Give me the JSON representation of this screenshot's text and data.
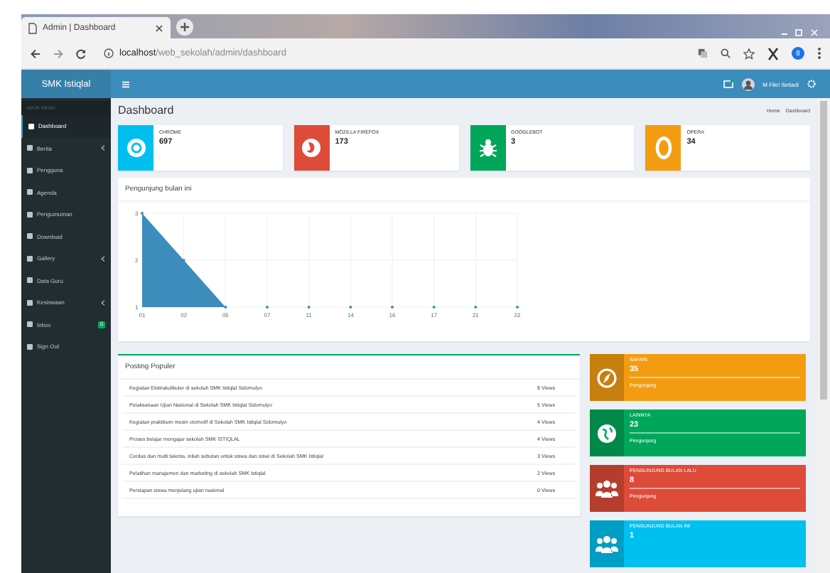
{
  "browser": {
    "tab_title": "Admin | Dashboard",
    "url_host": "localhost",
    "url_path": "/web_sekolah/admin/dashboard",
    "profile": "8"
  },
  "header": {
    "brand": "SMK Istiqlal",
    "user": "M Fikri Setiadi"
  },
  "sidebar": {
    "heading": "MAIN MENU",
    "items": [
      {
        "label": "Dashboard",
        "selected": true,
        "submenu": false
      },
      {
        "label": "Berita",
        "selected": false,
        "submenu": true
      },
      {
        "label": "Pengguna",
        "selected": false,
        "submenu": false
      },
      {
        "label": "Agenda",
        "selected": false,
        "submenu": false
      },
      {
        "label": "Pengumuman",
        "selected": false,
        "submenu": false
      },
      {
        "label": "Download",
        "selected": false,
        "submenu": false
      },
      {
        "label": "Gallery",
        "selected": false,
        "submenu": true
      },
      {
        "label": "Data Guru",
        "selected": false,
        "submenu": false
      },
      {
        "label": "Kesiswaan",
        "selected": false,
        "submenu": true
      },
      {
        "label": "Inbox",
        "selected": false,
        "submenu": false,
        "badge": "0"
      },
      {
        "label": "Sign Out",
        "selected": false,
        "submenu": false
      }
    ]
  },
  "page_title": "Dashboard",
  "breadcrumb": [
    "Home",
    "Dashboard"
  ],
  "browser_stats": [
    {
      "label": "CHROME",
      "value": "697",
      "color": "#00c0ef",
      "kind": "chrome"
    },
    {
      "label": "MOZILLA FIREFOX",
      "value": "173",
      "color": "#dd4b39",
      "kind": "firefox"
    },
    {
      "label": "GOOGLEBOT",
      "value": "3",
      "color": "#00a65a",
      "kind": "bug"
    },
    {
      "label": "OPERA",
      "value": "34",
      "color": "#f39c12",
      "kind": "opera"
    }
  ],
  "visitors_chart": {
    "title": "Pengunjung bulan ini",
    "chart_data": {
      "type": "area",
      "categories": [
        "01",
        "02",
        "05",
        "07",
        "11",
        "14",
        "16",
        "17",
        "21",
        "22"
      ],
      "series": [
        {
          "color": "#3c8dbc",
          "values": [
            3,
            2,
            1,
            1,
            1,
            1,
            1,
            1,
            1,
            1
          ]
        }
      ],
      "ylim": [
        1,
        3
      ],
      "yticks": [
        1,
        2,
        3
      ],
      "grid": true
    }
  },
  "popular_posts": {
    "title": "Posting Populer",
    "rows": [
      {
        "title": "Kegiatan Ekstrakulikuler di sekolah SMK Istiqlal Sidomulyo",
        "views": "8 Views"
      },
      {
        "title": "Pelaksanaan Ujian Nasional di Sekolah SMK Istiqlal Sidomulyo",
        "views": "5 Views"
      },
      {
        "title": "Kegiatan praktikum mesin otomotif di Sekolah SMK Istiqlal Sidomulyo",
        "views": "4 Views"
      },
      {
        "title": "Proses belajar mengajar sekolah SMK ISTIQLAL",
        "views": "4 Views"
      },
      {
        "title": "Cerdas dan multi talenta, inilah sebutan untuk siswa dan siswi di Sekolah SMK Istiqlal",
        "views": "3 Views"
      },
      {
        "title": "Pelatihan manajemen dan marketing di sekolah SMK Istiqlal",
        "views": "2 Views"
      },
      {
        "title": "Persiapan siswa menjelang ujian nasional",
        "views": "0 Views"
      }
    ]
  },
  "visitor_stats": [
    {
      "label": "SAFARI",
      "value": "35",
      "footer": "Pengunjung",
      "color": "#f39c12",
      "kind": "compass"
    },
    {
      "label": "LAINNYA",
      "value": "23",
      "footer": "Pengunjung",
      "color": "#00a65a",
      "kind": "globe"
    },
    {
      "label": "PENGUNJUNG BULAN LALU",
      "value": "8",
      "footer": "Pengunjung",
      "color": "#dd4b39",
      "kind": "users"
    },
    {
      "label": "PENGUNJUNG BULAN INI",
      "value": "1",
      "color": "#00c0ef",
      "kind": "users"
    }
  ]
}
